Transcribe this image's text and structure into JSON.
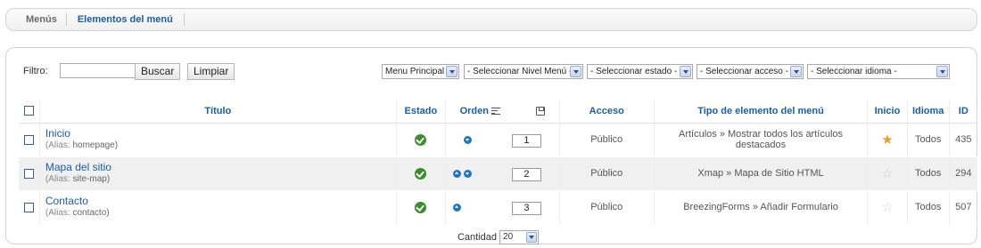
{
  "submenu": {
    "tabs": [
      {
        "label": "Menús"
      },
      {
        "label": "Elementos del menú"
      }
    ]
  },
  "filters": {
    "label": "Filtro:",
    "search_value": "",
    "search_button": "Buscar",
    "clear_button": "Limpiar",
    "menu_select": "Menu Principal",
    "level_select": "- Seleccionar Nivel Menú -",
    "state_select": "- Seleccionar estado -",
    "access_select": "- Seleccionar acceso -",
    "language_select": "- Seleccionar idioma -"
  },
  "table": {
    "headers": {
      "title": "Título",
      "state": "Estado",
      "order": "Orden",
      "access": "Acceso",
      "type": "Tipo de elemento del menú",
      "home": "Inicio",
      "language": "Idioma",
      "id": "ID"
    },
    "rows": [
      {
        "title": "Inicio",
        "alias_label": "(Alias:",
        "alias": "homepage)",
        "order": "1",
        "access": "Público",
        "type": "Artículos » Mostrar todos los artículos destacados",
        "language": "Todos",
        "id": "435",
        "home": true
      },
      {
        "title": "Mapa del sitio",
        "alias_label": "(Alias:",
        "alias": "site-map)",
        "order": "2",
        "access": "Público",
        "type": "Xmap » Mapa de Sitio HTML",
        "language": "Todos",
        "id": "294",
        "home": false
      },
      {
        "title": "Contacto",
        "alias_label": "(Alias:",
        "alias": "contacto)",
        "order": "3",
        "access": "Público",
        "type": "BreezingForms » Añadir Formulario",
        "language": "Todos",
        "id": "507",
        "home": false
      }
    ]
  },
  "footer": {
    "limit_label": "Cantidad",
    "limit_value": "20"
  }
}
